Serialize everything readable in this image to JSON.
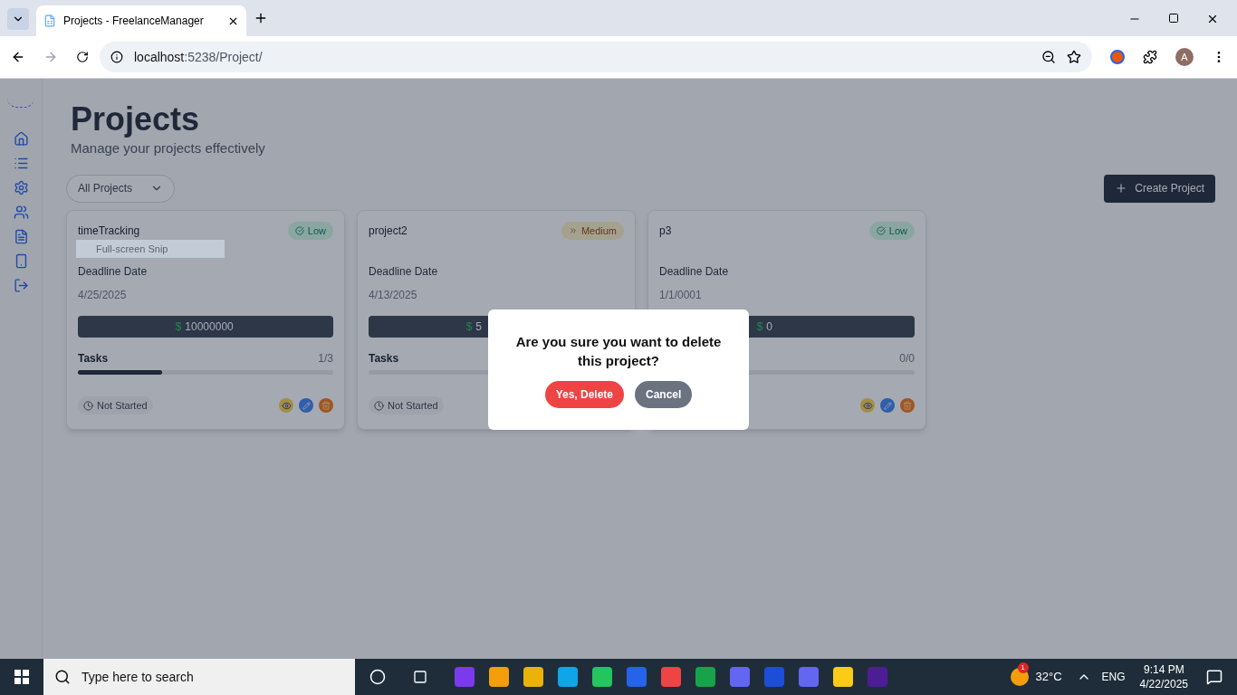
{
  "browser": {
    "tab_title": "Projects - FreelanceManager",
    "url_host": "localhost",
    "url_path": ":5238/Project/",
    "profile": "A"
  },
  "page": {
    "title": "Projects",
    "subtitle": "Manage your projects effectively",
    "filter": "All Projects",
    "create_button": "Create Project"
  },
  "projects": [
    {
      "name": "timeTracking",
      "priority": {
        "label": "Low",
        "kind": "low"
      },
      "deadline_label": "Deadline Date",
      "deadline": "4/25/2025",
      "currency": "$",
      "budget": "10000000",
      "tasks_label": "Tasks",
      "tasks_count": "1/3",
      "level": 0.33,
      "status": "Not Started"
    },
    {
      "name": "project2",
      "priority": {
        "label": "Medium",
        "kind": "medium"
      },
      "deadline_label": "Deadline Date",
      "deadline": "4/13/2025",
      "currency": "$",
      "budget": "5",
      "tasks_label": "Tasks",
      "level": 0,
      "status": "Not Started"
    },
    {
      "name": "p3",
      "priority": {
        "label": "Low",
        "kind": "low"
      },
      "deadline_label": "Deadline Date",
      "deadline": "1/1/0001",
      "currency": "$",
      "budget": "0",
      "tasks_count": "0/0",
      "level": 0
    }
  ],
  "snip_tooltip": "Full-screen Snip",
  "modal": {
    "message": "Are you sure you want to delete this project?",
    "confirm": "Yes, Delete",
    "cancel": "Cancel"
  },
  "taskbar": {
    "search_placeholder": "Type here to search",
    "weather_badge": "1",
    "temperature": "32°C",
    "language": "ENG",
    "time": "9:14 PM",
    "date": "4/22/2025"
  }
}
